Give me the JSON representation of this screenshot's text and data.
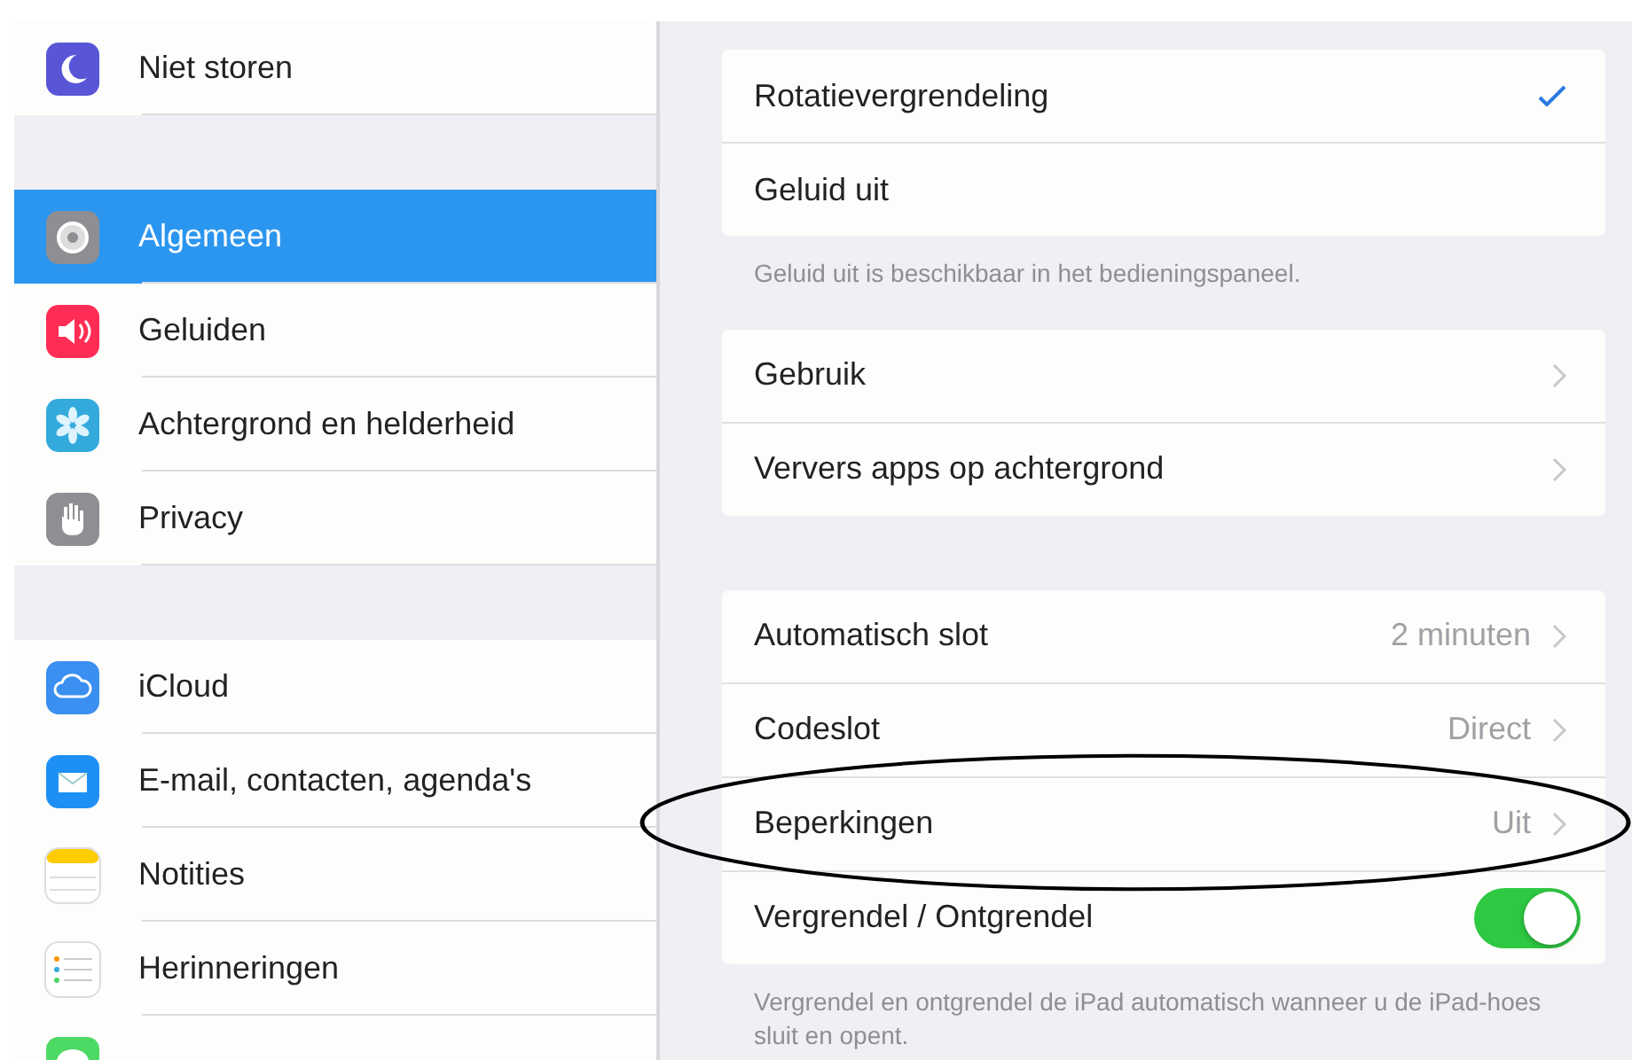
{
  "sidebar": {
    "groups": [
      {
        "items": [
          {
            "label": "Niet storen",
            "selected": false
          }
        ]
      },
      {
        "items": [
          {
            "label": "Algemeen",
            "selected": true
          },
          {
            "label": "Geluiden",
            "selected": false
          },
          {
            "label": "Achtergrond en helderheid",
            "selected": false
          },
          {
            "label": "Privacy",
            "selected": false
          }
        ]
      },
      {
        "items": [
          {
            "label": "iCloud",
            "selected": false
          },
          {
            "label": "E-mail, contacten, agenda's",
            "selected": false
          },
          {
            "label": "Notities",
            "selected": false
          },
          {
            "label": "Herinneringen",
            "selected": false
          },
          {
            "selected": false
          }
        ]
      }
    ]
  },
  "settings": {
    "sections": [
      {
        "rows": [
          {
            "kind": "check",
            "label": "Rotatievergrendeling",
            "checked": true
          },
          {
            "kind": "check",
            "label": "Geluid uit",
            "checked": false
          }
        ],
        "footer": "Geluid uit is beschikbaar in het bedieningspaneel."
      },
      {
        "rows": [
          {
            "kind": "link",
            "label": "Gebruik"
          },
          {
            "kind": "link",
            "label": "Ververs apps op achtergrond"
          }
        ]
      },
      {
        "rows": [
          {
            "kind": "link",
            "label": "Automatisch slot",
            "value": "2 minuten"
          },
          {
            "kind": "link",
            "label": "Codeslot",
            "value": "Direct"
          },
          {
            "kind": "link",
            "label": "Beperkingen",
            "value": "Uit"
          },
          {
            "kind": "switch",
            "label": "Vergrendel / Ontgrendel",
            "on": true
          }
        ],
        "footer": "Vergrendel en ontgrendel de iPad automatisch wanneer u de iPad-hoes sluit en opent."
      }
    ]
  }
}
